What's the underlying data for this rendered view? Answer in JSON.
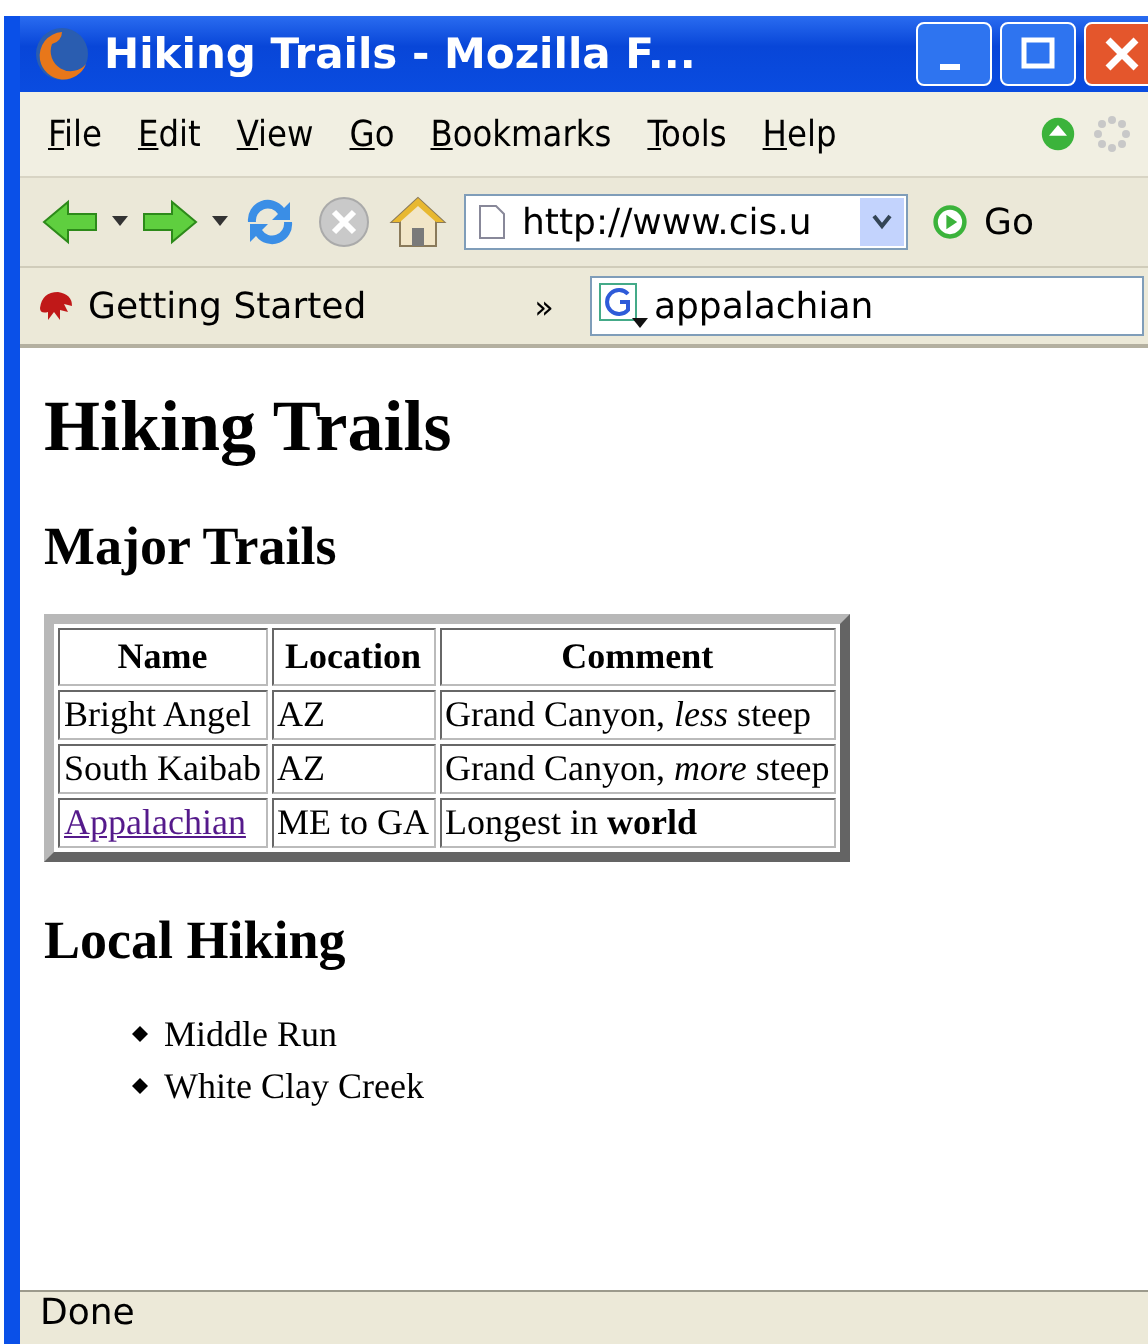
{
  "window": {
    "title": "Hiking Trails - Mozilla F..."
  },
  "menu": [
    "File",
    "Edit",
    "View",
    "Go",
    "Bookmarks",
    "Tools",
    "Help"
  ],
  "address": {
    "value": "http://www.cis.u",
    "go": "Go"
  },
  "bookmarks": {
    "items": [
      "Getting Started"
    ],
    "overflow": "»"
  },
  "search": {
    "value": "appalachian"
  },
  "page": {
    "heading": "Hiking Trails",
    "sections": [
      {
        "heading": "Major Trails",
        "kind": "table",
        "columns": [
          "Name",
          "Location",
          "Comment"
        ],
        "rows": [
          {
            "cells": [
              "Bright Angel",
              "AZ",
              "Grand Canyon, *less* steep"
            ],
            "link": false
          },
          {
            "cells": [
              "South Kaibab",
              "AZ",
              "Grand Canyon, *more* steep"
            ],
            "link": false
          },
          {
            "cells": [
              "Appalachian",
              "ME to GA",
              "Longest in **world**"
            ],
            "link": true
          }
        ]
      },
      {
        "heading": "Local Hiking",
        "kind": "list",
        "items": [
          "Middle Run",
          "White Clay Creek"
        ]
      }
    ]
  },
  "status_bar": "Done"
}
